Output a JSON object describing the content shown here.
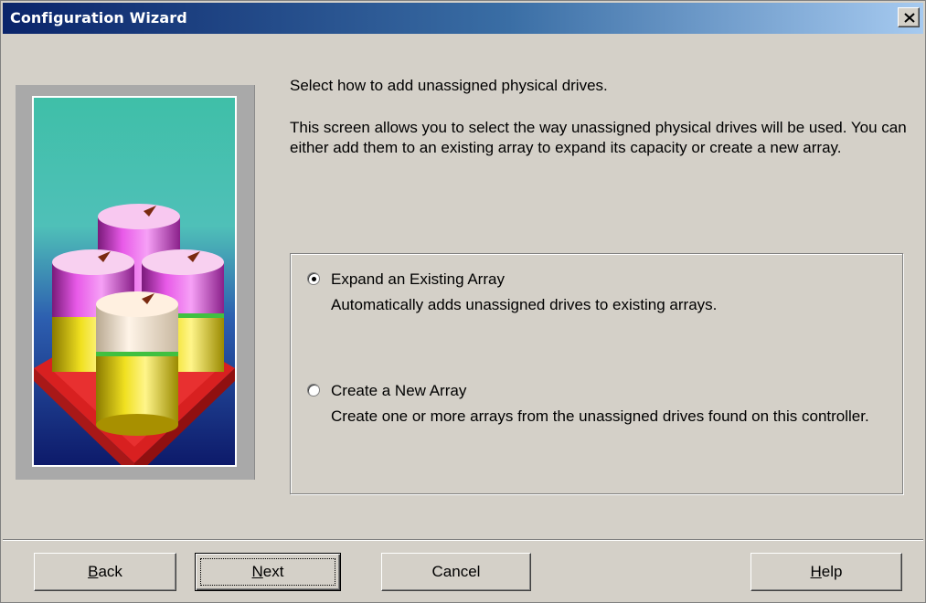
{
  "window": {
    "title": "Configuration Wizard",
    "close_label": "×"
  },
  "illustration": {
    "icon": "drive-array-illustration"
  },
  "content": {
    "intro": "Select how to add unassigned physical drives.",
    "description": "This screen allows you to select the way unassigned physical drives will be used. You can either add them to an existing array to expand its capacity or create a new array."
  },
  "options": [
    {
      "label": "Expand an Existing Array",
      "description": "Automatically adds unassigned drives to existing arrays.",
      "selected": true
    },
    {
      "label": "Create a New Array",
      "description": "Create one or more arrays from the unassigned drives found on this controller.",
      "selected": false
    }
  ],
  "buttons": {
    "back": {
      "accel": "B",
      "rest": "ack"
    },
    "next": {
      "accel": "N",
      "rest": "ext"
    },
    "cancel": "Cancel",
    "help": {
      "accel": "H",
      "rest": "elp"
    }
  },
  "colors": {
    "title_bar_start": "#0a246a",
    "title_bar_end": "#a6caf0",
    "dialog_face": "#d4d0c8"
  }
}
